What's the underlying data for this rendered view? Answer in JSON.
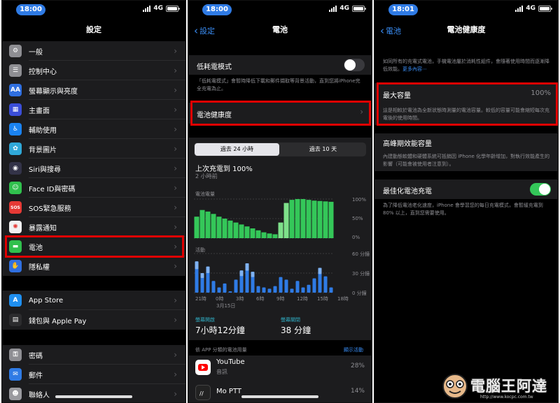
{
  "panel1": {
    "time": "18:00",
    "network": "4G",
    "title": "設定",
    "group1": [
      {
        "label": "一般",
        "icon": "gear-icon",
        "color": "#8e8e93",
        "glyph": "⚙"
      },
      {
        "label": "控制中心",
        "icon": "toggles-icon",
        "color": "#8e8e93",
        "glyph": "☰"
      },
      {
        "label": "螢幕顯示與亮度",
        "icon": "display-brightness-icon",
        "color": "#2f6fe0",
        "glyph": "AA"
      },
      {
        "label": "主畫面",
        "icon": "home-screen-icon",
        "color": "#3b4ed8",
        "glyph": "▦"
      },
      {
        "label": "輔助使用",
        "icon": "accessibility-icon",
        "color": "#1a82f0",
        "glyph": "♿"
      },
      {
        "label": "背景圖片",
        "icon": "wallpaper-icon",
        "color": "#30a8d8",
        "glyph": "✿"
      },
      {
        "label": "Siri與搜尋",
        "icon": "siri-icon",
        "color": "#333348",
        "glyph": "◉"
      },
      {
        "label": "Face ID與密碼",
        "icon": "face-id-icon",
        "color": "#30c04d",
        "glyph": "☺"
      },
      {
        "label": "SOS緊急服務",
        "icon": "sos-icon",
        "color": "#e53935",
        "glyph": "SOS"
      },
      {
        "label": "暴露通知",
        "icon": "exposure-notification-icon",
        "color": "#f2f2f2",
        "glyph": "✺"
      },
      {
        "label": "電池",
        "icon": "battery-icon",
        "color": "#30c04d",
        "glyph": "▬"
      },
      {
        "label": "隱私權",
        "icon": "privacy-hand-icon",
        "color": "#2f6fe0",
        "glyph": "✋"
      }
    ],
    "group2": [
      {
        "label": "App Store",
        "icon": "app-store-icon",
        "color": "#1f8ff0",
        "glyph": "A"
      },
      {
        "label": "錢包與 Apple Pay",
        "icon": "wallet-icon",
        "color": "#2c2c2e",
        "glyph": "▤"
      }
    ],
    "group3": [
      {
        "label": "密碼",
        "icon": "key-icon",
        "color": "#8e8e93",
        "glyph": "⚿"
      },
      {
        "label": "郵件",
        "icon": "mail-icon",
        "color": "#2f7be5",
        "glyph": "✉"
      },
      {
        "label": "聯絡人",
        "icon": "contacts-icon",
        "color": "#9a9a9f",
        "glyph": "☻"
      }
    ]
  },
  "panel2": {
    "time": "18:00",
    "network": "4G",
    "back_label": "設定",
    "title": "電池",
    "low_power_label": "低耗電模式",
    "low_power_note": "「低耗電模式」會暫時降低下載和郵件擷取等背景活動，直到您將iPhone完全充電為止。",
    "health_label": "電池健康度",
    "tab_24h": "過去 24 小時",
    "tab_10d": "過去 10 天",
    "last_charged": "上次充電到 100%",
    "last_charged_ago": "2 小時前",
    "battery_level_label": "電池電量",
    "level_ticks": [
      "100%",
      "50%",
      "0%"
    ],
    "activity_label": "活動",
    "activity_ticks": [
      "60 分鐘",
      "30 分鐘",
      "0 分鐘"
    ],
    "hour_ticks": [
      "21時",
      "0時",
      "3時",
      "6時",
      "9時",
      "12時",
      "15時",
      "18時"
    ],
    "date_tick": "3月15日",
    "screen_on_label": "螢幕開啟",
    "screen_on_value": "7小時12分鐘",
    "screen_off_label": "螢幕關閉",
    "screen_off_value": "38 分鐘",
    "by_app_label": "依 APP 分類的電池用量",
    "show_activity": "顯示活動",
    "apps": [
      {
        "name": "YouTube",
        "sub": "音訊",
        "pct": "28%",
        "icon": "youtube-icon"
      },
      {
        "name": "Mo PTT",
        "sub": "",
        "pct": "14%",
        "icon": "moptt-icon"
      }
    ],
    "level_series": [
      0.55,
      0.72,
      0.68,
      0.62,
      0.55,
      0.5,
      0.45,
      0.4,
      0.35,
      0.3,
      0.25,
      0.2,
      0.15,
      0.12,
      0.1,
      0.4,
      0.9,
      0.98,
      1.0,
      1.0,
      0.98,
      0.96,
      0.95,
      0.94,
      0.93
    ],
    "activity_series": [
      48,
      30,
      40,
      18,
      8,
      14,
      2,
      20,
      34,
      45,
      32,
      10,
      8,
      6,
      10,
      24,
      20,
      6,
      18,
      8,
      12,
      22,
      38,
      25,
      8
    ]
  },
  "panel3": {
    "time": "18:01",
    "network": "4G",
    "back_label": "電池",
    "title": "電池健康度",
    "intro": "如同所有的充電式電池，手機電池屬於消耗性組件，會隨著使用時間而逐漸降低效能。",
    "learn_more": "更多內容⋯",
    "max_capacity_label": "最大容量",
    "max_capacity_value": "100%",
    "max_capacity_note": "這是相較於電池為全新狀態時測量的電池容量。較低的容量可能會縮短每次充電後的使用時間。",
    "peak_label": "高峰期效能容量",
    "peak_note": "內建動態軟體和硬體系統可抵銷因 iPhone 化學年齡增加，對執行效能產生的影響（可能會被使用者注意到）。",
    "optimized_label": "最佳化電池充電",
    "optimized_note": "為了降低電池老化速度，iPhone 會學習您的每日充電模式，會暫緩充電到 80% 以上，直到您需要使用。"
  },
  "watermark": {
    "text": "電腦王阿達",
    "url": "http://www.kocpc.com.tw"
  },
  "colors": {
    "accent": "#3a8ef6",
    "highlight": "#e00000",
    "green": "#34c759",
    "blue_bar": "#2f7be5"
  }
}
